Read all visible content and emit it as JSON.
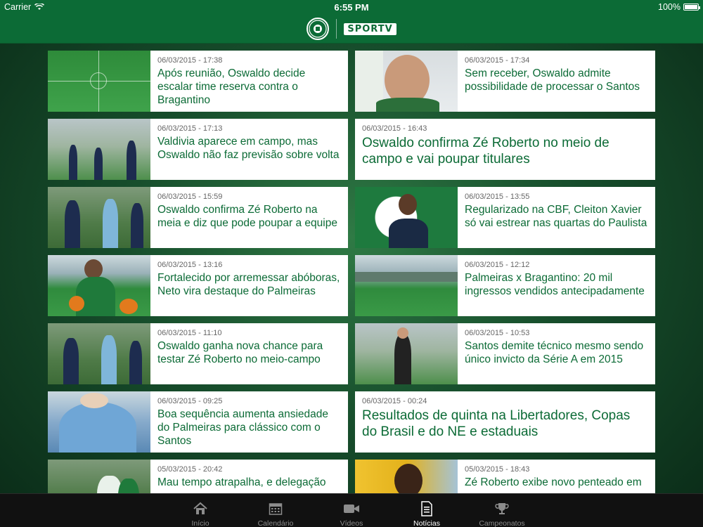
{
  "status_bar": {
    "carrier": "Carrier",
    "time": "6:55 PM",
    "battery": "100%"
  },
  "header": {
    "club_logo": "palmeiras-crest",
    "partner_logo": "SPORTV"
  },
  "news": [
    {
      "date": "06/03/2015 - 17:38",
      "title": "Após reunião, Oswaldo decide escalar time reserva contra o Bragantino",
      "thumb": "tactics-field"
    },
    {
      "date": "06/03/2015 - 17:34",
      "title": "Sem receber, Oswaldo admite possibilidade de processar o Santos",
      "thumb": "coach-press"
    },
    {
      "date": "06/03/2015 - 17:13",
      "title": "Valdivia aparece em campo, mas Oswaldo não faz previsão sobre volta",
      "thumb": "training"
    },
    {
      "date": "06/03/2015 - 16:43",
      "title": "Oswaldo confirma Zé Roberto no meio de campo e vai poupar titulares",
      "thumb": null
    },
    {
      "date": "06/03/2015 - 15:59",
      "title": "Oswaldo confirma Zé Roberto na meia e diz que pode poupar a equipe",
      "thumb": "training-players"
    },
    {
      "date": "06/03/2015 - 13:55",
      "title": "Regularizado na CBF, Cleiton Xavier só vai estrear nas quartas do Paulista",
      "thumb": "player-crest"
    },
    {
      "date": "06/03/2015 - 13:16",
      "title": "Fortalecido por arremessar abóboras, Neto vira destaque do Palmeiras",
      "thumb": "player-pumpkins"
    },
    {
      "date": "06/03/2015 - 12:12",
      "title": "Palmeiras x Bragantino: 20 mil ingressos vendidos antecipadamente",
      "thumb": "stadium"
    },
    {
      "date": "06/03/2015 - 11:10",
      "title": "Oswaldo ganha nova chance para testar Zé Roberto no meio-campo",
      "thumb": "training-players"
    },
    {
      "date": "06/03/2015 - 10:53",
      "title": "Santos demite técnico mesmo sendo único invicto da Série A em 2015",
      "thumb": "santos-training"
    },
    {
      "date": "06/03/2015 - 09:25",
      "title": "Boa sequência aumenta ansiedade do Palmeiras para clássico com o Santos",
      "thumb": "player-blue"
    },
    {
      "date": "06/03/2015 - 00:24",
      "title": "Resultados de quinta na Libertadores, Copas do Brasil e do NE e estaduais",
      "thumb": null
    },
    {
      "date": "05/03/2015 - 20:42",
      "title": "Mau tempo atrapalha, e delegação",
      "thumb": "delegation"
    },
    {
      "date": "05/03/2015 - 18:43",
      "title": "Zé Roberto exibe novo penteado em",
      "thumb": "ze-roberto"
    }
  ],
  "tabs": [
    {
      "label": "Início",
      "icon": "home-icon",
      "active": false
    },
    {
      "label": "Calendário",
      "icon": "calendar-icon",
      "active": false
    },
    {
      "label": "Vídeos",
      "icon": "video-camera-icon",
      "active": false
    },
    {
      "label": "Notícias",
      "icon": "news-document-icon",
      "active": true
    },
    {
      "label": "Campeonatos",
      "icon": "trophy-icon",
      "active": false
    }
  ],
  "colors": {
    "brand_green": "#0c6b36",
    "headline_green": "#0c6b36",
    "tabbar_bg": "#111111"
  }
}
